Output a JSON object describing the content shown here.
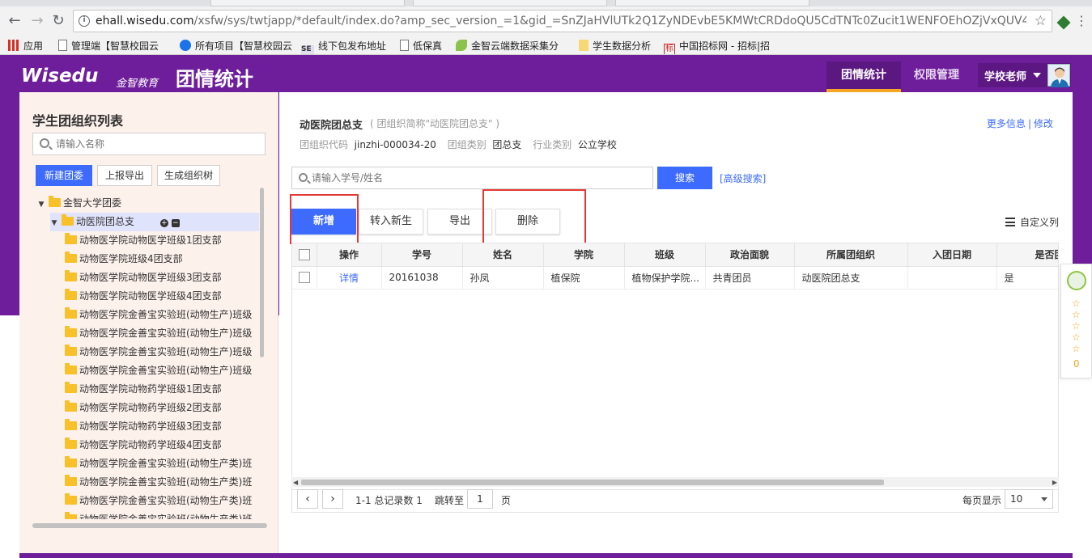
{
  "browser": {
    "url_main": "ehall.wisedu.com",
    "url_rest": "/xsfw/sys/twtjapp/*default/index.do?amp_sec_version_=1&gid_=SnZJaHVlUTk2Q1ZyNDEvbE5KMWtCRDdoQU5CdTNTc0Zucit1WENFOEhOZjVxQUV4W...",
    "bookmarks": [
      "应用",
      "管理端【智慧校园云",
      "所有项目【智慧校园云",
      "线下包发布地址",
      "低保真",
      "金智云端数据采集分",
      "学生数据分析",
      "中国招标网 - 招标|招"
    ],
    "bookmark_tag_se": "SE",
    "bookmark_tag_biao": "标"
  },
  "header": {
    "logo_text": "Wisedu",
    "logo_cn": "金智教育",
    "app_title": "团情统计",
    "tabs": [
      "团情统计",
      "权限管理"
    ],
    "active_tab": 0,
    "user_name": "学校老师",
    "colors": {
      "brand": "#6e1e9a",
      "accent": "#f5a623",
      "primary_button": "#3d6bff"
    }
  },
  "left_panel": {
    "title": "学生团组织列表",
    "search_placeholder": "请输入名称",
    "buttons": [
      "新建团委",
      "上报导出",
      "生成组织树"
    ],
    "tree": {
      "root": "金智大学团委",
      "selected": "动医院团总支",
      "children": [
        "动物医学院动物医学班级1团支部",
        "动物医学院班级4团支部",
        "动物医学院动物医学班级3团支部",
        "动物医学院动物医学班级4团支部",
        "动物医学院金善宝实验班(动物生产)班级",
        "动物医学院金善宝实验班(动物生产)班级",
        "动物医学院金善宝实验班(动物生产)班级",
        "动物医学院金善宝实验班(动物生产)班级",
        "动物医学院动物药学班级1团支部",
        "动物医学院动物药学班级2团支部",
        "动物医学院动物药学班级3团支部",
        "动物医学院动物药学班级4团支部",
        "动物医学院金善宝实验班(动物生产类)班",
        "动物医学院金善宝实验班(动物生产类)班",
        "动物医学院金善宝实验班(动物生产类)班",
        "动物医学院金善宝实验班(动物生产类)班"
      ]
    }
  },
  "main": {
    "org_name": "动医院团总支",
    "org_short": "( 团组织简称\"动医院团总支\" )",
    "meta": [
      {
        "label": "团组织代码",
        "value": "jinzhi-000034-20"
      },
      {
        "label": "团组类别",
        "value": "团总支"
      },
      {
        "label": "行业类别",
        "value": "公立学校"
      }
    ],
    "more_info": "更多信息",
    "link_sep": "|",
    "edit": "修改",
    "search_placeholder": "请输入学号/姓名",
    "search_button": "搜索",
    "advanced_search": "[高级搜索]",
    "actions": [
      "新增",
      "转入新生",
      "导出",
      "删除"
    ],
    "custom_columns": "自定义列",
    "table": {
      "columns": [
        "操作",
        "学号",
        "姓名",
        "学院",
        "班级",
        "政治面貌",
        "所属团组织",
        "入团日期",
        "是否团"
      ],
      "rows": [
        {
          "action": "详情",
          "id": "20161038",
          "name": "孙凤",
          "college": "植保院",
          "class": "植物保护学院...",
          "political": "共青团员",
          "org": "动医院团总支",
          "join_date": "",
          "flag": "是"
        }
      ]
    },
    "pager": {
      "summary": "1-1 总记录数 1",
      "jump_label": "跳转至",
      "page_value": "1",
      "page_unit": "页",
      "per_page_label": "每页显示",
      "per_page_value": "10"
    }
  },
  "widget": {
    "count": "0"
  }
}
